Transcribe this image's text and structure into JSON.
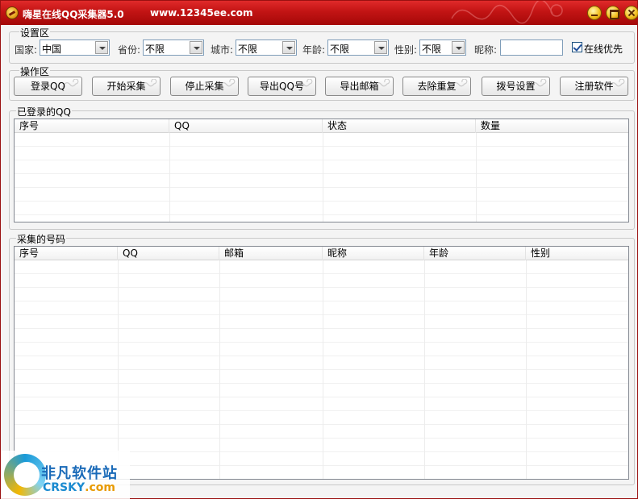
{
  "window": {
    "title": "嗨星在线QQ采集器5.0",
    "url": "www.12345ee.com"
  },
  "settings": {
    "group_title": "设置区",
    "country_label": "国家:",
    "country_value": "中国",
    "province_label": "省份:",
    "province_value": "不限",
    "city_label": "城市:",
    "city_value": "不限",
    "age_label": "年龄:",
    "age_value": "不限",
    "gender_label": "性别:",
    "gender_value": "不限",
    "nickname_label": "昵称:",
    "nickname_value": "",
    "online_first_label": "在线优先",
    "online_first_checked": true
  },
  "operations": {
    "group_title": "操作区",
    "buttons": [
      "登录QQ",
      "开始采集",
      "停止采集",
      "导出QQ号",
      "导出邮箱",
      "去除重复",
      "拨号设置",
      "注册软件"
    ]
  },
  "logged_in": {
    "group_title": "已登录的QQ",
    "columns": [
      "序号",
      "QQ",
      "状态",
      "数量"
    ]
  },
  "collected": {
    "group_title": "采集的号码",
    "columns": [
      "序号",
      "QQ",
      "邮箱",
      "昵称",
      "年龄",
      "性别"
    ]
  },
  "watermark": {
    "cn": "非凡软件站",
    "en_main": "CRSKY",
    "en_suffix": ".com"
  },
  "colors": {
    "titlebar": "#c21414",
    "accent_link": "#1a6ab8"
  }
}
